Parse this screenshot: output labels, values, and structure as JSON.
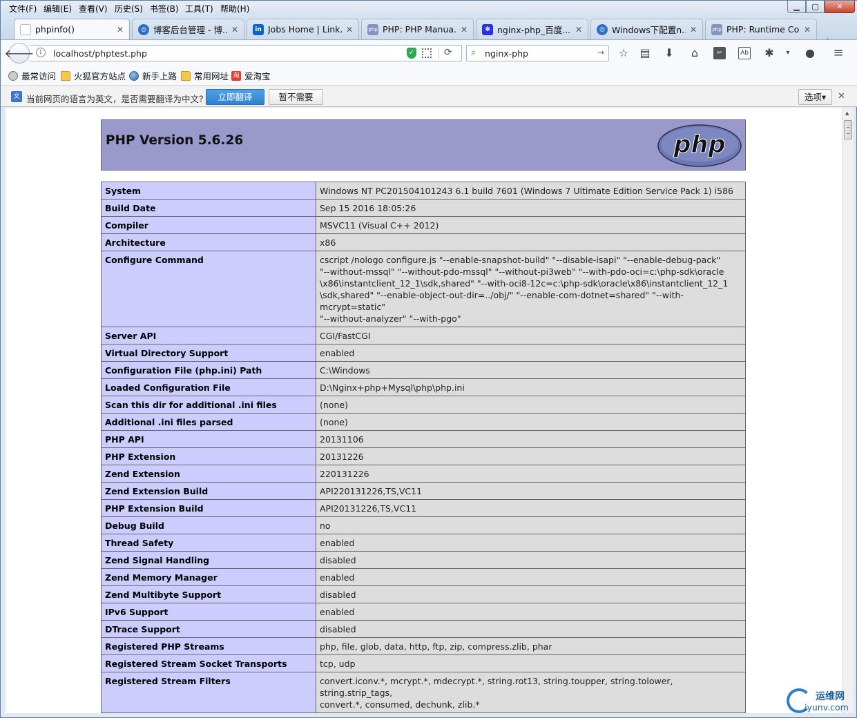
{
  "menubar": {
    "items": [
      "文件(F)",
      "编辑(E)",
      "查看(V)",
      "历史(S)",
      "书签(B)",
      "工具(T)",
      "帮助(H)"
    ]
  },
  "tabs": [
    {
      "title": "phpinfo()",
      "icon": "blank-page-icon",
      "active": true
    },
    {
      "title": "博客后台管理 - 博...",
      "icon": "site-globe-icon",
      "active": false
    },
    {
      "title": "Jobs Home | Link...",
      "icon": "linkedin-icon",
      "active": false
    },
    {
      "title": "PHP: PHP Manua...",
      "icon": "php-icon",
      "active": false
    },
    {
      "title": "nginx-php_百度...",
      "icon": "baidu-paw-icon",
      "active": false
    },
    {
      "title": "Windows下配置n...",
      "icon": "site-globe-icon",
      "active": false
    },
    {
      "title": "PHP: Runtime Co...",
      "icon": "php-icon",
      "active": false
    }
  ],
  "navbar": {
    "url": "localhost/phptest.php",
    "search_query": "nginx-php"
  },
  "bookmarks": [
    "最常访问",
    "火狐官方站点",
    "新手上路",
    "常用网址",
    "爱淘宝"
  ],
  "translate_bar": {
    "message": "当前网页的语言为英文，是否需要翻译为中文？",
    "translate_label": "立即翻译",
    "decline_label": "暂不需要",
    "options_label": "选项▾"
  },
  "phpinfo": {
    "heading": "PHP Version 5.6.26",
    "logo_text": "php",
    "rows": [
      {
        "key": "System",
        "value": "Windows NT PC201504101243 6.1 build 7601 (Windows 7 Ultimate Edition Service Pack 1) i586"
      },
      {
        "key": "Build Date",
        "value": "Sep 15 2016 18:05:26"
      },
      {
        "key": "Compiler",
        "value": "MSVC11 (Visual C++ 2012)"
      },
      {
        "key": "Architecture",
        "value": "x86"
      },
      {
        "key": "Configure Command",
        "lines": [
          "cscript /nologo configure.js \"--enable-snapshot-build\" \"--disable-isapi\" \"--enable-debug-pack\"",
          "\"--without-mssql\" \"--without-pdo-mssql\" \"--without-pi3web\" \"--with-pdo-oci=c:\\php-sdk\\oracle",
          "\\x86\\instantclient_12_1\\sdk,shared\" \"--with-oci8-12c=c:\\php-sdk\\oracle\\x86\\instantclient_12_1",
          "\\sdk,shared\" \"--enable-object-out-dir=../obj/\" \"--enable-com-dotnet=shared\" \"--with-mcrypt=static\"",
          "\"--without-analyzer\" \"--with-pgo\""
        ]
      },
      {
        "key": "Server API",
        "value": "CGI/FastCGI"
      },
      {
        "key": "Virtual Directory Support",
        "value": "enabled"
      },
      {
        "key": "Configuration File (php.ini) Path",
        "value": "C:\\Windows"
      },
      {
        "key": "Loaded Configuration File",
        "value": "D:\\Nginx+php+Mysql\\php\\php.ini"
      },
      {
        "key": "Scan this dir for additional .ini files",
        "value": "(none)"
      },
      {
        "key": "Additional .ini files parsed",
        "value": "(none)"
      },
      {
        "key": "PHP API",
        "value": "20131106"
      },
      {
        "key": "PHP Extension",
        "value": "20131226"
      },
      {
        "key": "Zend Extension",
        "value": "220131226"
      },
      {
        "key": "Zend Extension Build",
        "value": "API220131226,TS,VC11"
      },
      {
        "key": "PHP Extension Build",
        "value": "API20131226,TS,VC11"
      },
      {
        "key": "Debug Build",
        "value": "no"
      },
      {
        "key": "Thread Safety",
        "value": "enabled"
      },
      {
        "key": "Zend Signal Handling",
        "value": "disabled"
      },
      {
        "key": "Zend Memory Manager",
        "value": "enabled"
      },
      {
        "key": "Zend Multibyte Support",
        "value": "disabled"
      },
      {
        "key": "IPv6 Support",
        "value": "enabled"
      },
      {
        "key": "DTrace Support",
        "value": "disabled"
      },
      {
        "key": "Registered PHP Streams",
        "value": "php, file, glob, data, http, ftp, zip, compress.zlib, phar"
      },
      {
        "key": "Registered Stream Socket Transports",
        "value": "tcp, udp"
      },
      {
        "key": "Registered Stream Filters",
        "lines": [
          "convert.iconv.*, mcrypt.*, mdecrypt.*, string.rot13, string.toupper, string.tolower, string.strip_tags,",
          "convert.*, consumed, dechunk, zlib.*"
        ]
      }
    ]
  },
  "watermark": {
    "cn": "运维网",
    "en": "iyunv.com"
  },
  "colors": {
    "php_header": "#9999cc",
    "php_key_cell": "#ccccff",
    "php_value_cell": "#dddddd",
    "translate_button": "#2f82cf"
  }
}
